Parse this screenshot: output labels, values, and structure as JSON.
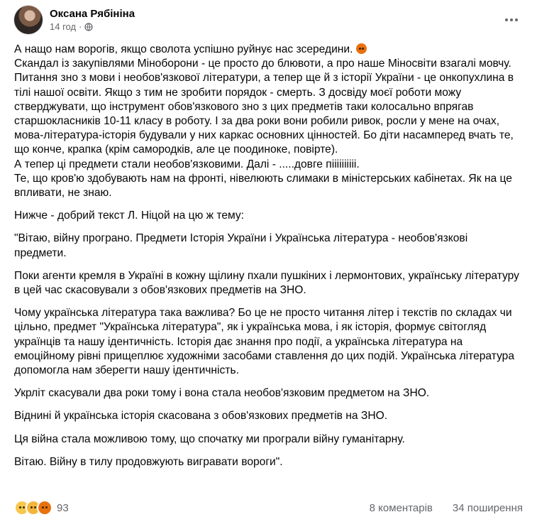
{
  "post": {
    "author": "Оксана Рябініна",
    "time": "14 год",
    "dot": "·",
    "paragraphs": [
      "А нащо нам ворогів, якщо сволота успішно руйнує нас зсередини.",
      "Скандал із закупівлями Міноборони - це просто до блювоти, а про наше Міносвіти взагалі мовчу. Питання зно з мови і необов'язкової  літератури, а тепер  ще й з історії України - це онкопухлина в тілі нашої освіти. Якщо з тим не зробити порядок - смерть. З досвіду моєї роботи можу стверджувати, що інструмент обов'язкового зно з цих предметів таки колосально впрягав старшокласників 10-11 класу в роботу. І за два роки вони робили ривок, росли у мене на очах, мова-література-історія будували у них каркас основних цінностей. Бо діти насамперед вчать те, що конче, крапка (крім самородків, але це поодиноке, повірте).",
      "А тепер ці предмети стали необов'язковими. Далі - .....довге піііііііііі.",
      "Те, що кров'ю здобувають нам на фронті, нівелюють слимаки в міністерських кабінетах. Як на це впливати, не знаю.",
      "Нижче - добрий текст Л. Ніцой на цю ж тему:",
      "\"Вітаю, війну програно. Предмети Історія України і Українська література - необов'язкові предмети.",
      "Поки агенти кремля в Україні в кожну щілину пхали пушкіних і лермонтових, українську літературу в цей час скасовували з обов'язкових предметів на ЗНО.",
      "Чому українська література така важлива? Бо це не просто читання літер і текстів по складах чи цільно, предмет \"Українська література\", як і українська мова, і як історія, формує світогляд українців та нашу ідентичність. Історія дає знання про події, а українська література на емоційному рівні прищеплює художніми засобами ставлення до цих подій. Українська література допомогла нам зберегти нашу ідентичність.",
      "Укрліт скасували два роки тому і вона стала необов'язковим предметом на ЗНО.",
      "Віднині й українська історія скасована з обов'язкових предметів на ЗНО.",
      "Ця війна стала можливою тому, що спочатку ми програли війну гуманітарну.",
      "Вітаю. Війну в тилу продовжують вигравати вороги\"."
    ],
    "reactions_count": "93",
    "comments": "8 коментарів",
    "shares": "34 поширення"
  },
  "icons": [
    "globe-icon",
    "more-options-icon",
    "angry-emoji-icon",
    "sad-reaction-icon",
    "angry-reaction-icon"
  ]
}
